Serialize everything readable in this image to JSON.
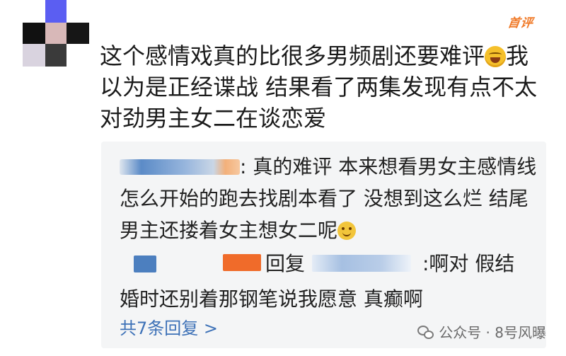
{
  "badge": {
    "label": "首评"
  },
  "post": {
    "text_part1": "这个感情戏真的比很多男频剧还要难评",
    "emoji_icon": "laughing-crying-emoji",
    "text_part2": "我以为是正经谍战 结果看了两集发现有点不太对劲男主女二在谈恋爱"
  },
  "reply1": {
    "text": ": 真的难评 本来想看男女主感情线怎么开始的跑去找剧本看了 没想到这么烂 结尾男主还搂着女主想女二呢",
    "emoji_icon": "smiling-emoji"
  },
  "reply2": {
    "reply_word": "回复",
    "text_tail": ":啊对 假结",
    "text_line2": "婚时还别着那钢笔说我愿意 真癫啊"
  },
  "more_replies": {
    "label": "共7条回复 >"
  },
  "watermark": {
    "icon": "wechat-icon",
    "text": "公众号 · 8号风曝"
  },
  "colors": {
    "accent_orange": "#f07a28",
    "link_blue": "#3d71b7",
    "box_bg": "#f4f5f6"
  }
}
